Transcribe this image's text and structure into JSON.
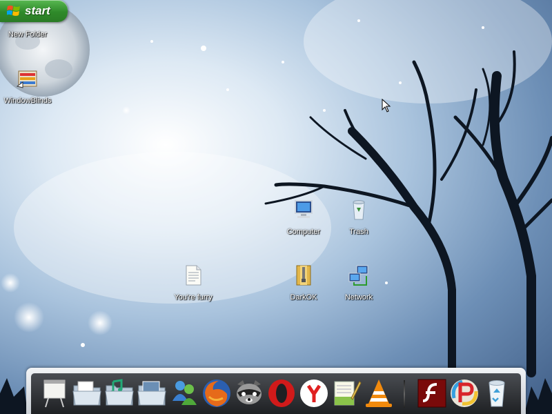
{
  "start": {
    "label": "start"
  },
  "desktop_icons": [
    {
      "label": "New Folder",
      "icon": "folder-icon"
    },
    {
      "label": "WindowBlinds",
      "icon": "windowblinds-icon"
    },
    {
      "label": "Computer",
      "icon": "computer-icon"
    },
    {
      "label": "Trash",
      "icon": "trash-icon"
    },
    {
      "label": "You're furry",
      "icon": "text-document-icon"
    },
    {
      "label": "DarkOK",
      "icon": "zip-folder-icon"
    },
    {
      "label": "Network",
      "icon": "network-icon"
    }
  ],
  "dock": {
    "items": [
      {
        "name": "presentation",
        "icon": "presentation-board-icon"
      },
      {
        "name": "documents",
        "icon": "documents-folder-icon"
      },
      {
        "name": "music",
        "icon": "music-folder-icon"
      },
      {
        "name": "pictures",
        "icon": "pictures-folder-icon"
      },
      {
        "name": "messenger",
        "icon": "messenger-icon"
      },
      {
        "name": "firefox",
        "icon": "firefox-icon"
      },
      {
        "name": "raccoon",
        "icon": "raccoon-icon"
      },
      {
        "name": "opera",
        "icon": "opera-icon"
      },
      {
        "name": "yandex",
        "icon": "yandex-icon"
      },
      {
        "name": "notepad",
        "icon": "notepad-icon"
      },
      {
        "name": "vlc",
        "icon": "vlc-icon"
      },
      {
        "name": "flash",
        "icon": "flash-icon"
      },
      {
        "name": "paint",
        "icon": "paint-p-icon"
      },
      {
        "name": "recycle-bin",
        "icon": "recycle-bin-icon"
      }
    ]
  },
  "colors": {
    "start_green": "#2f8a2a",
    "dock_dark": "#1e2023",
    "sky_blue": "#6d8fb6"
  }
}
